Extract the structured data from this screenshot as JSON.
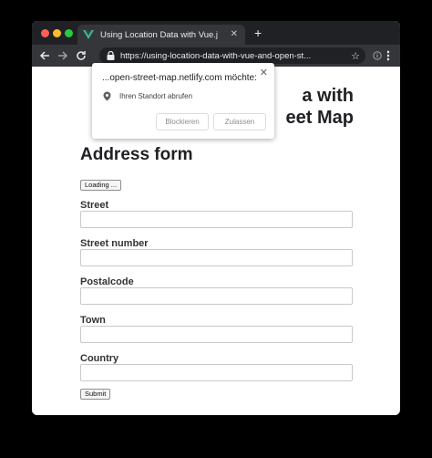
{
  "colors": {
    "close": "#ff5f57",
    "minimize": "#febc2e",
    "maximize": "#28c840",
    "vue_green": "#41b883",
    "vue_dark": "#35495e"
  },
  "browser": {
    "tab_title": "Using Location Data with Vue.j",
    "tab_close": "✕",
    "new_tab": "+",
    "url": "https://using-location-data-with-vue-and-open-st...",
    "icons": {
      "back": "arrow-left-icon",
      "forward": "arrow-right-icon",
      "reload": "reload-icon",
      "lock": "lock-icon",
      "bookmark": "star-icon",
      "extension": "info-icon",
      "menu": "kebab-menu-icon"
    }
  },
  "popup": {
    "title": "...open-street-map.netlify.com möchte:",
    "permission": "Ihren Standort abrufen",
    "block_label": "Blockieren",
    "allow_label": "Zulassen",
    "close": "✕"
  },
  "page": {
    "heading": "a with\neet Map",
    "heading_line1": "a with",
    "heading_line2": "eet Map",
    "form_title": "Address form",
    "loading_label": "Loading ...",
    "fields": [
      {
        "label": "Street",
        "value": ""
      },
      {
        "label": "Street number",
        "value": ""
      },
      {
        "label": "Postalcode",
        "value": ""
      },
      {
        "label": "Town",
        "value": ""
      },
      {
        "label": "Country",
        "value": ""
      }
    ],
    "submit_label": "Submit"
  }
}
